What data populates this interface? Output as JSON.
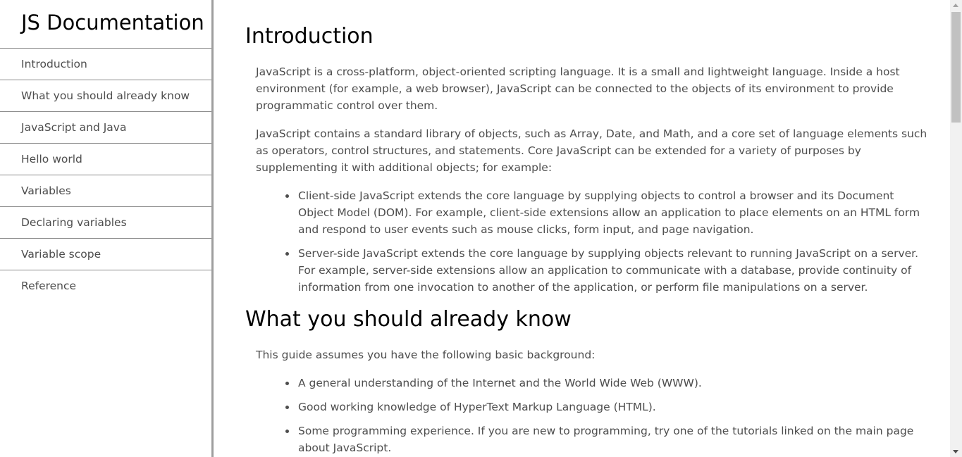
{
  "navbar": {
    "title": "JS Documentation",
    "items": [
      {
        "label": "Introduction"
      },
      {
        "label": "What you should already know"
      },
      {
        "label": "JavaScript and Java"
      },
      {
        "label": "Hello world"
      },
      {
        "label": "Variables"
      },
      {
        "label": "Declaring variables"
      },
      {
        "label": "Variable scope"
      },
      {
        "label": "Reference"
      }
    ]
  },
  "main": {
    "introduction": {
      "title": "Introduction",
      "paragraphs": [
        "JavaScript is a cross-platform, object-oriented scripting language. It is a small and lightweight language. Inside a host environment (for example, a web browser), JavaScript can be connected to the objects of its environment to provide programmatic control over them.",
        "JavaScript contains a standard library of objects, such as Array, Date, and Math, and a core set of language elements such as operators, control structures, and statements. Core JavaScript can be extended for a variety of purposes by supplementing it with additional objects; for example:"
      ],
      "bullets": [
        "Client-side JavaScript extends the core language by supplying objects to control a browser and its Document Object Model (DOM). For example, client-side extensions allow an application to place elements on an HTML form and respond to user events such as mouse clicks, form input, and page navigation.",
        "Server-side JavaScript extends the core language by supplying objects relevant to running JavaScript on a server. For example, server-side extensions allow an application to communicate with a database, provide continuity of information from one invocation to another of the application, or perform file manipulations on a server."
      ]
    },
    "what_you_should_know": {
      "title": "What you should already know",
      "paragraphs": [
        "This guide assumes you have the following basic background:"
      ],
      "bullets": [
        "A general understanding of the Internet and the World Wide Web (WWW).",
        "Good working knowledge of HyperText Markup Language (HTML).",
        "Some programming experience. If you are new to programming, try one of the tutorials linked on the main page about JavaScript."
      ]
    }
  },
  "colors": {
    "nav_border": "#9e9e9e",
    "text": "#4d4d4d",
    "heading": "#000000"
  }
}
